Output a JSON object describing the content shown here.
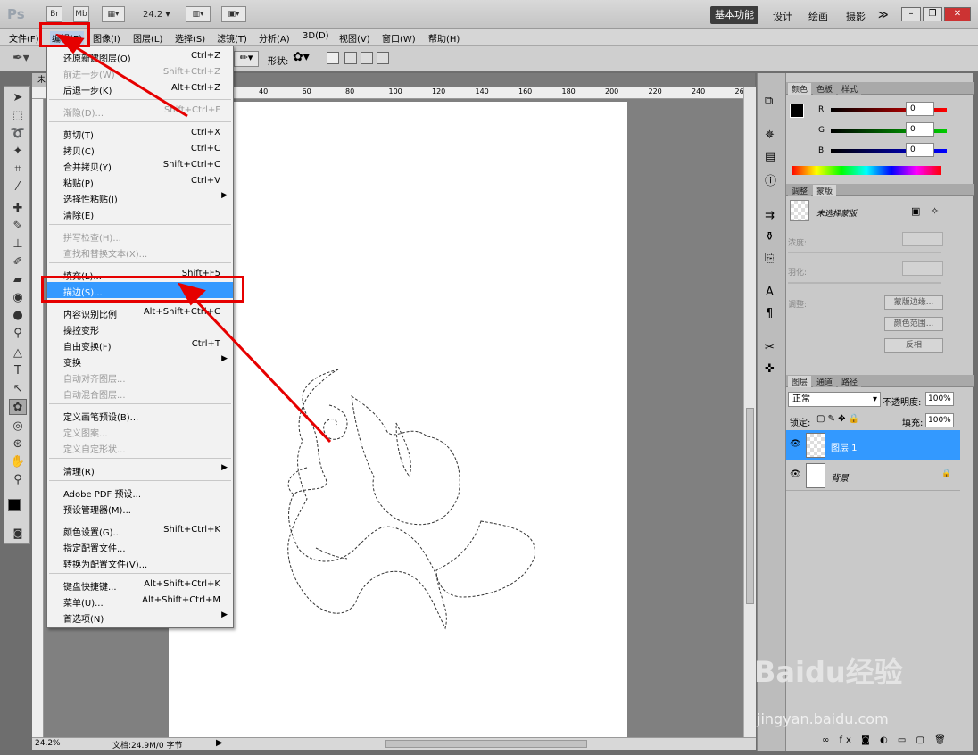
{
  "app": {
    "logo": "Ps",
    "br": "Br",
    "mb": "Mb",
    "zoom": "24.2",
    "workspaces": [
      "基本功能",
      "设计",
      "绘画",
      "摄影"
    ],
    "more": "≫"
  },
  "menubar": [
    "文件(F)",
    "编辑(E)",
    "图像(I)",
    "图层(L)",
    "选择(S)",
    "滤镜(T)",
    "分析(A)",
    "3D(D)",
    "视图(V)",
    "窗口(W)",
    "帮助(H)"
  ],
  "options": {
    "shape_label": "形状:"
  },
  "document": {
    "tab": "未"
  },
  "ruler_h": [
    "40",
    "60",
    "80",
    "100",
    "120",
    "140",
    "160",
    "180",
    "200",
    "220",
    "240",
    "26"
  ],
  "status": {
    "zoom": "24.2%",
    "doc": "文档:24.9M/0 字节"
  },
  "edit_menu": [
    {
      "label": "还原新建图层(O)",
      "shortcut": "Ctrl+Z"
    },
    {
      "label": "前进一步(W)",
      "shortcut": "Shift+Ctrl+Z",
      "disabled": true
    },
    {
      "label": "后退一步(K)",
      "shortcut": "Alt+Ctrl+Z"
    },
    {
      "sep": true
    },
    {
      "label": "渐隐(D)...",
      "shortcut": "Shift+Ctrl+F",
      "disabled": true
    },
    {
      "sep": true
    },
    {
      "label": "剪切(T)",
      "shortcut": "Ctrl+X"
    },
    {
      "label": "拷贝(C)",
      "shortcut": "Ctrl+C"
    },
    {
      "label": "合并拷贝(Y)",
      "shortcut": "Shift+Ctrl+C"
    },
    {
      "label": "粘贴(P)",
      "shortcut": "Ctrl+V"
    },
    {
      "label": "选择性粘贴(I)",
      "shortcut": "",
      "submenu": true
    },
    {
      "label": "清除(E)",
      "shortcut": ""
    },
    {
      "sep": true
    },
    {
      "label": "拼写检查(H)...",
      "shortcut": "",
      "disabled": true
    },
    {
      "label": "查找和替换文本(X)...",
      "shortcut": "",
      "disabled": true
    },
    {
      "sep": true
    },
    {
      "label": "填充(L)...",
      "shortcut": "Shift+F5"
    },
    {
      "label": "描边(S)...",
      "shortcut": "",
      "highlight": true
    },
    {
      "sep": true
    },
    {
      "label": "内容识别比例",
      "shortcut": "Alt+Shift+Ctrl+C"
    },
    {
      "label": "操控变形",
      "shortcut": ""
    },
    {
      "label": "自由变换(F)",
      "shortcut": "Ctrl+T"
    },
    {
      "label": "变换",
      "shortcut": "",
      "submenu": true
    },
    {
      "label": "自动对齐图层...",
      "shortcut": "",
      "disabled": true
    },
    {
      "label": "自动混合图层...",
      "shortcut": "",
      "disabled": true
    },
    {
      "sep": true
    },
    {
      "label": "定义画笔预设(B)...",
      "shortcut": ""
    },
    {
      "label": "定义图案...",
      "shortcut": "",
      "disabled": true
    },
    {
      "label": "定义自定形状...",
      "shortcut": "",
      "disabled": true
    },
    {
      "sep": true
    },
    {
      "label": "清理(R)",
      "shortcut": "",
      "submenu": true
    },
    {
      "sep": true
    },
    {
      "label": "Adobe PDF 预设...",
      "shortcut": ""
    },
    {
      "label": "预设管理器(M)...",
      "shortcut": ""
    },
    {
      "sep": true
    },
    {
      "label": "颜色设置(G)...",
      "shortcut": "Shift+Ctrl+K"
    },
    {
      "label": "指定配置文件...",
      "shortcut": ""
    },
    {
      "label": "转换为配置文件(V)...",
      "shortcut": ""
    },
    {
      "sep": true
    },
    {
      "label": "键盘快捷键...",
      "shortcut": "Alt+Shift+Ctrl+K"
    },
    {
      "label": "菜单(U)...",
      "shortcut": "Alt+Shift+Ctrl+M"
    },
    {
      "label": "首选项(N)",
      "shortcut": "",
      "submenu": true
    }
  ],
  "color_panel": {
    "tabs": [
      "颜色",
      "色板",
      "样式"
    ],
    "channels": [
      {
        "name": "R",
        "value": "0",
        "color": "#ff0000"
      },
      {
        "name": "G",
        "value": "0",
        "color": "#00cc00"
      },
      {
        "name": "B",
        "value": "0",
        "color": "#0000ff"
      }
    ]
  },
  "masks_panel": {
    "tabs": [
      "调整",
      "蒙版"
    ],
    "title": "未选择蒙版",
    "density": "浓度:",
    "feather": "羽化:",
    "adjust": "调整:",
    "buttons": [
      "蒙版边缘...",
      "颜色范围...",
      "反相"
    ]
  },
  "layers_panel": {
    "tabs": [
      "图层",
      "通道",
      "路径"
    ],
    "blend_mode": "正常",
    "opacity_label": "不透明度:",
    "opacity": "100%",
    "lock_label": "锁定:",
    "fill_label": "填充:",
    "fill": "100%",
    "layers": [
      {
        "name": "图层 1",
        "selected": true
      },
      {
        "name": "背景",
        "selected": false,
        "locked": true
      }
    ]
  },
  "watermark": {
    "brand": "Baidu经验",
    "url": "jingyan.baidu.com"
  },
  "colors": {
    "highlight": "#3399ff",
    "annotation": "#e60000"
  }
}
